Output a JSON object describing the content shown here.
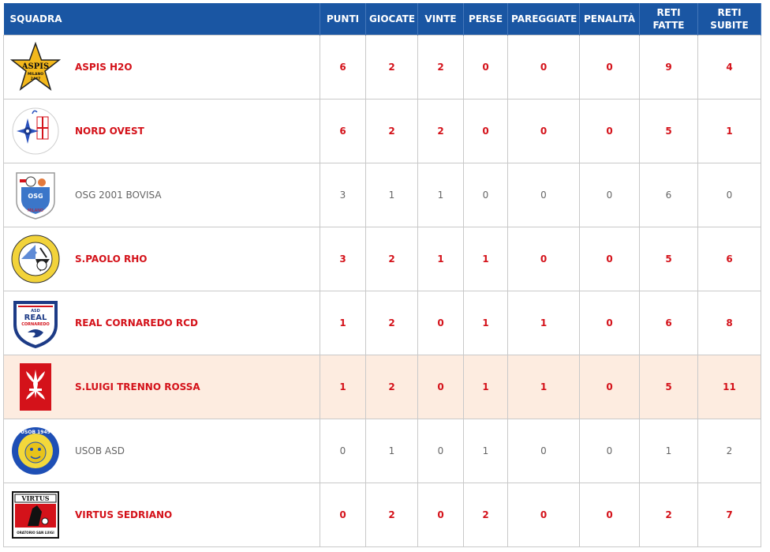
{
  "headers": {
    "squadra": "SQUADRA",
    "punti": "PUNTI",
    "giocate": "GIOCATE",
    "vinte": "VINTE",
    "perse": "PERSE",
    "pareggiate": "PAREGGIATE",
    "penalita": "PENALITÀ",
    "reti_fatte_1": "RETI",
    "reti_fatte_2": "FATTE",
    "reti_subite_1": "RETI",
    "reti_subite_2": "SUBITE"
  },
  "rows": [
    {
      "name": "ASPIS H2O",
      "punti": "6",
      "giocate": "2",
      "vinte": "2",
      "perse": "0",
      "pareggiate": "0",
      "penalita": "0",
      "reti_fatte": "9",
      "reti_subite": "4",
      "logo": "aspis-logo",
      "logo_text1": "ASPIS",
      "logo_text2": "MILANO",
      "logo_text3": "2447"
    },
    {
      "name": "NORD OVEST",
      "punti": "6",
      "giocate": "2",
      "vinte": "2",
      "perse": "0",
      "pareggiate": "0",
      "penalita": "0",
      "reti_fatte": "5",
      "reti_subite": "1",
      "logo": "nord-ovest-logo"
    },
    {
      "name": "OSG 2001 BOVISA",
      "punti": "3",
      "giocate": "1",
      "vinte": "1",
      "perse": "0",
      "pareggiate": "0",
      "penalita": "0",
      "reti_fatte": "6",
      "reti_subite": "0",
      "logo": "osg-logo",
      "logo_text1": "OSG",
      "logo_text2": "MILANO"
    },
    {
      "name": "S.PAOLO RHO",
      "punti": "3",
      "giocate": "2",
      "vinte": "1",
      "perse": "1",
      "pareggiate": "0",
      "penalita": "0",
      "reti_fatte": "5",
      "reti_subite": "6",
      "logo": "spaolo-logo"
    },
    {
      "name": "REAL CORNAREDO RCD",
      "punti": "1",
      "giocate": "2",
      "vinte": "0",
      "perse": "1",
      "pareggiate": "1",
      "penalita": "0",
      "reti_fatte": "6",
      "reti_subite": "8",
      "logo": "real-cornaredo-logo",
      "logo_text1": "ASD",
      "logo_text2": "REAL",
      "logo_text3": "CORNAREDO"
    },
    {
      "name": "S.LUIGI TRENNO ROSSA",
      "punti": "1",
      "giocate": "2",
      "vinte": "0",
      "perse": "1",
      "pareggiate": "1",
      "penalita": "0",
      "reti_fatte": "5",
      "reti_subite": "11",
      "logo": "sluigi-logo"
    },
    {
      "name": "USOB ASD",
      "punti": "0",
      "giocate": "1",
      "vinte": "0",
      "perse": "1",
      "pareggiate": "0",
      "penalita": "0",
      "reti_fatte": "1",
      "reti_subite": "2",
      "logo": "usob-logo",
      "logo_text1": "USOB 1949"
    },
    {
      "name": "VIRTUS SEDRIANO",
      "punti": "0",
      "giocate": "2",
      "vinte": "0",
      "perse": "2",
      "pareggiate": "0",
      "penalita": "0",
      "reti_fatte": "2",
      "reti_subite": "7",
      "logo": "virtus-logo",
      "logo_text1": "VIRTUS",
      "logo_text2": "ORATORIO SAN LUIGI"
    }
  ],
  "colors": {
    "header_bg": "#1a56a3",
    "highlight_text": "#d4121a",
    "highlight_row_bg": "#fdece0",
    "normal_text": "#666666"
  }
}
